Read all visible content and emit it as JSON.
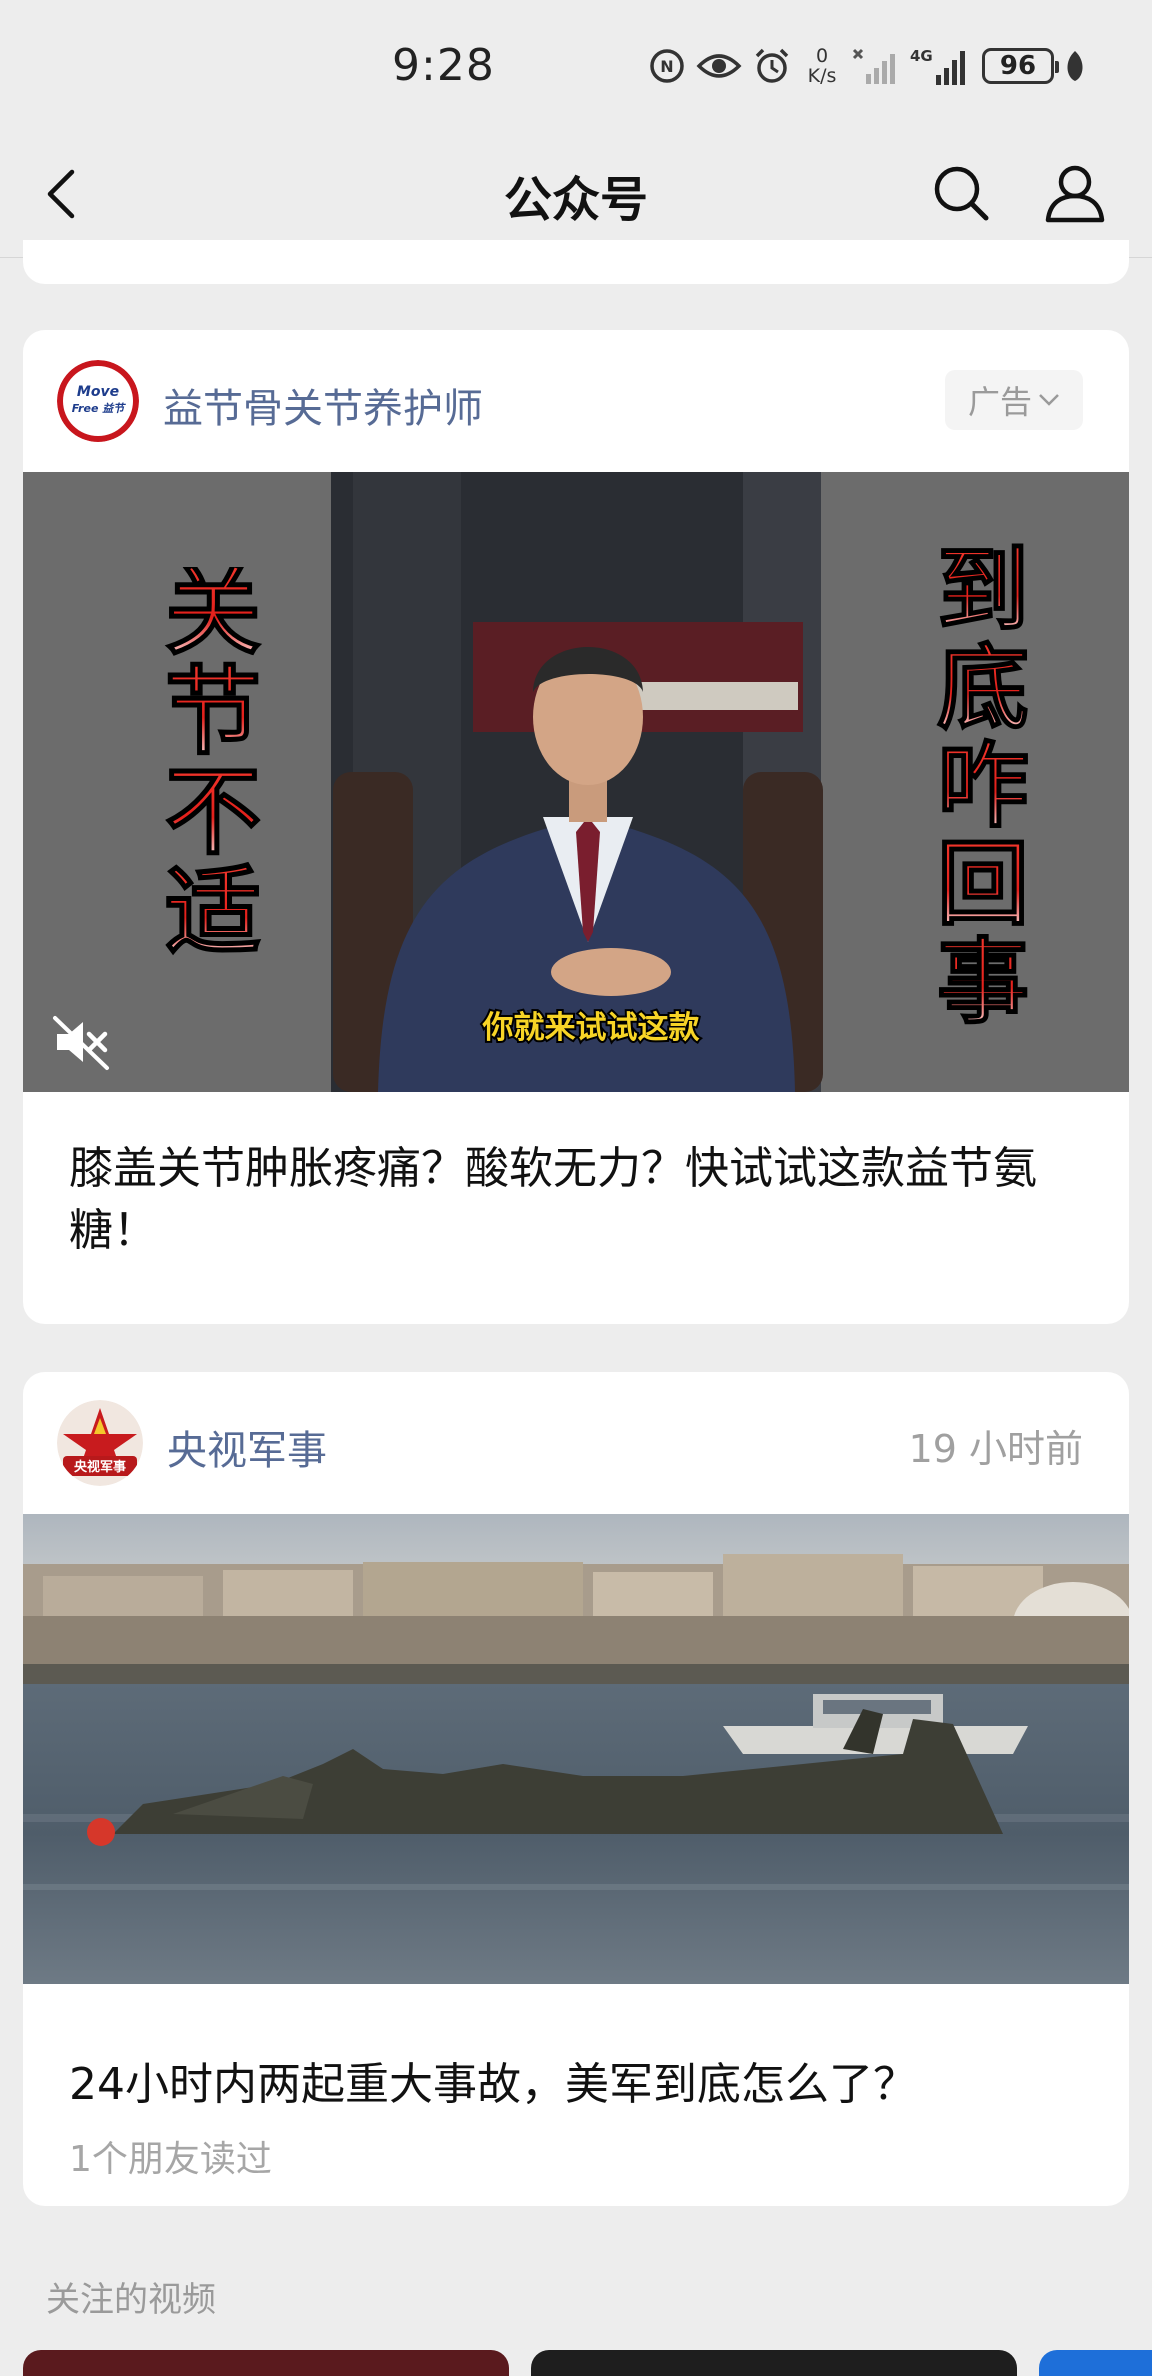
{
  "status_bar": {
    "time": "9:28",
    "net_speed_value": "0",
    "net_speed_unit": "K/s",
    "network_type": "4G",
    "battery": "96"
  },
  "nav": {
    "title": "公众号",
    "icons": [
      "back-arrow-icon",
      "search-icon",
      "profile-icon"
    ]
  },
  "feed": [
    {
      "type": "ad",
      "account_name": "益节骨关节养护师",
      "avatar_text": [
        "Move",
        "Free 益节"
      ],
      "ad_label": "广告",
      "video": {
        "overlay_left": [
          "关",
          "节",
          "不",
          "适"
        ],
        "overlay_right": [
          "到",
          "底",
          "咋",
          "回",
          "事"
        ],
        "subtitle": "你就来试试这款",
        "muted": true
      },
      "title": "膝盖关节肿胀疼痛？酸软无力？快试试这款益节氨糖！"
    },
    {
      "type": "article",
      "account_name": "央视军事",
      "avatar_text": "央视军事",
      "time_ago": "19 小时前",
      "title": "24小时内两起重大事故，美军到底怎么了？",
      "sub": "1个朋友读过"
    }
  ],
  "sections": {
    "followed_videos": "关注的视频"
  },
  "colors": {
    "background": "#ededed",
    "link_blue": "#576b95",
    "overlay_red": "#e8211b"
  }
}
